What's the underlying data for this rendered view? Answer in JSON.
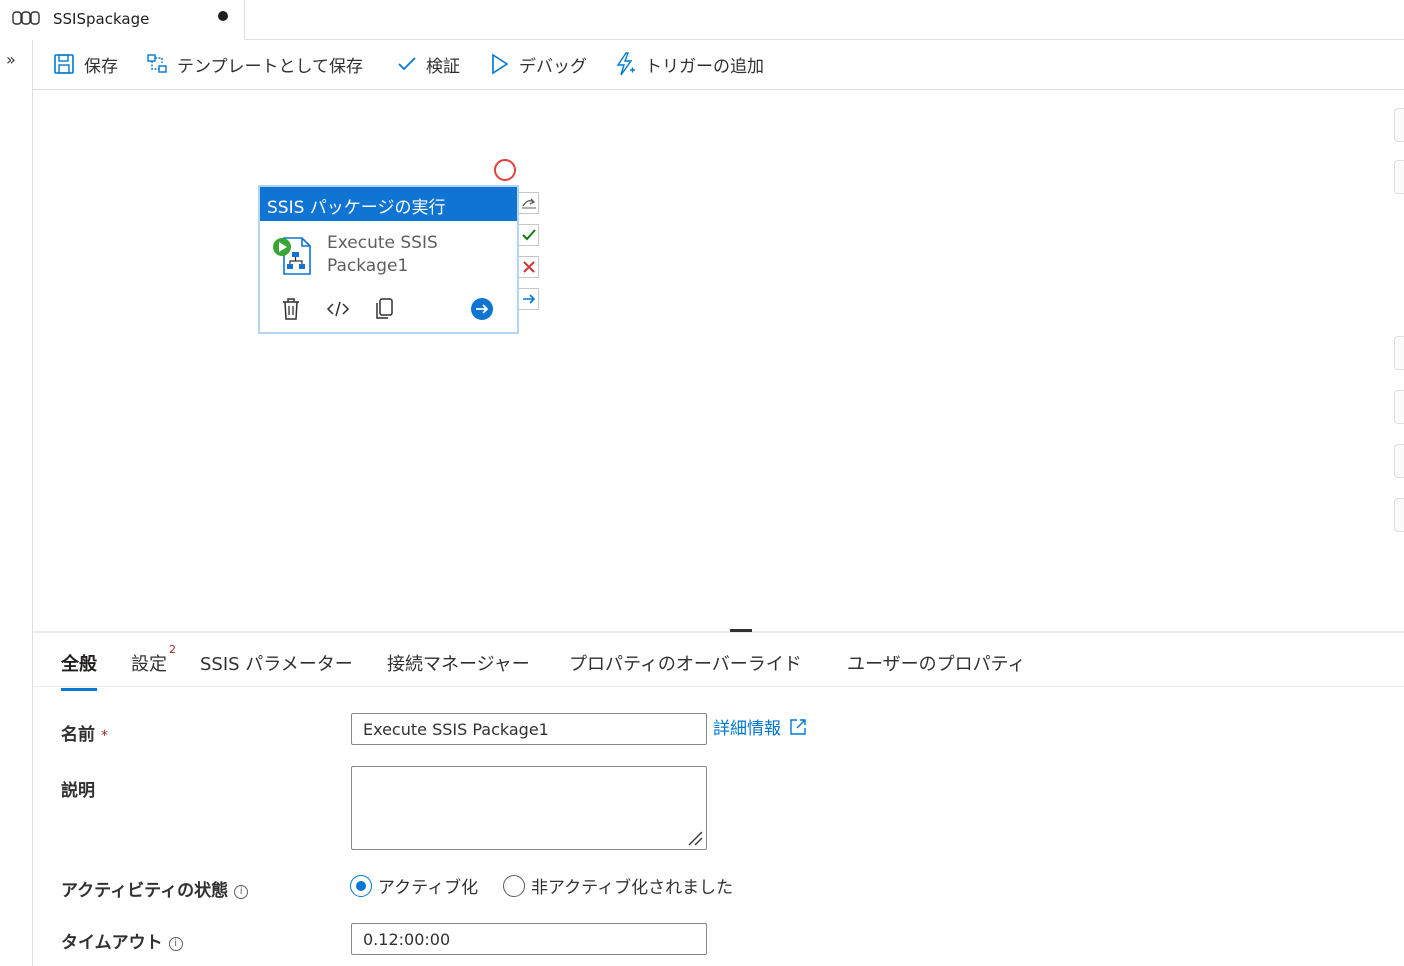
{
  "tab": {
    "title": "SSISpackage",
    "icon": "pipeline-icon",
    "unsaved": true
  },
  "leftstrip": {
    "expand_glyph": "»"
  },
  "toolbar": {
    "save": "保存",
    "save_template": "テンプレートとして保存",
    "validate": "検証",
    "debug": "デバッグ",
    "add_trigger": "トリガーの追加"
  },
  "activity": {
    "header": "SSIS パッケージの実行",
    "name_line1": "Execute SSIS",
    "name_line2": "Package1",
    "header_color": "#0f74d2",
    "icons": [
      "delete-icon",
      "code-icon",
      "copy-icon",
      "arrow-right-circle-icon"
    ]
  },
  "connectors": [
    "skip-icon",
    "success-icon",
    "failure-icon",
    "completion-icon"
  ],
  "property_tabs": [
    {
      "label": "全般",
      "active": true
    },
    {
      "label": "設定",
      "badge": "2"
    },
    {
      "label": "SSIS パラメーター"
    },
    {
      "label": "接続マネージャー"
    },
    {
      "label": "プロパティのオーバーライド"
    },
    {
      "label": "ユーザーのプロパティ"
    }
  ],
  "form": {
    "name_label": "名前",
    "required_mark": "*",
    "name_value": "Execute SSIS Package1",
    "learn_more": "詳細情報",
    "description_label": "説明",
    "description_value": "",
    "state_label": "アクティビティの状態",
    "state_options": [
      "アクティブ化",
      "非アクティブ化されました"
    ],
    "state_selected": "アクティブ化",
    "timeout_label": "タイムアウト",
    "timeout_value": "0.12:00:00",
    "info_glyph": "i"
  },
  "colors": {
    "accent": "#0078d4",
    "required": "#a4262c",
    "error_marker": "#e3413c"
  }
}
